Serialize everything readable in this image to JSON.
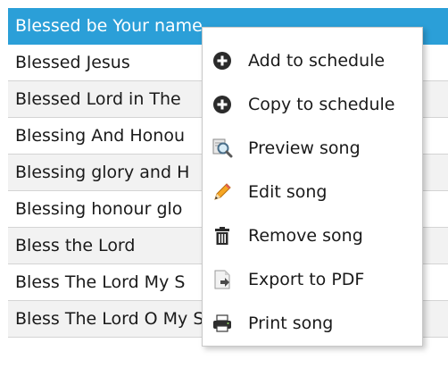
{
  "song_list": {
    "rows": [
      {
        "title": "Blessed be Your name"
      },
      {
        "title": "Blessed Jesus"
      },
      {
        "title": "Blessed Lord in The"
      },
      {
        "title": "Blessing And Honou"
      },
      {
        "title": "Blessing glory and H"
      },
      {
        "title": "Blessing honour glo"
      },
      {
        "title": "Bless the Lord"
      },
      {
        "title": "Bless The Lord My S"
      },
      {
        "title": "Bless The Lord O My Soul"
      }
    ]
  },
  "context_menu": {
    "items": [
      {
        "label": "Add to schedule",
        "icon": "plus-circle-icon"
      },
      {
        "label": "Copy to schedule",
        "icon": "plus-circle-icon"
      },
      {
        "label": "Preview song",
        "icon": "magnifier-preview-icon"
      },
      {
        "label": "Edit song",
        "icon": "pencil-icon"
      },
      {
        "label": "Remove song",
        "icon": "trash-icon"
      },
      {
        "label": "Export to PDF",
        "icon": "document-export-icon"
      },
      {
        "label": "Print song",
        "icon": "printer-icon"
      }
    ]
  },
  "colors": {
    "selection": "#2b9fd8",
    "row_alt": "#f2f2f2",
    "text": "#1a1a1a"
  }
}
